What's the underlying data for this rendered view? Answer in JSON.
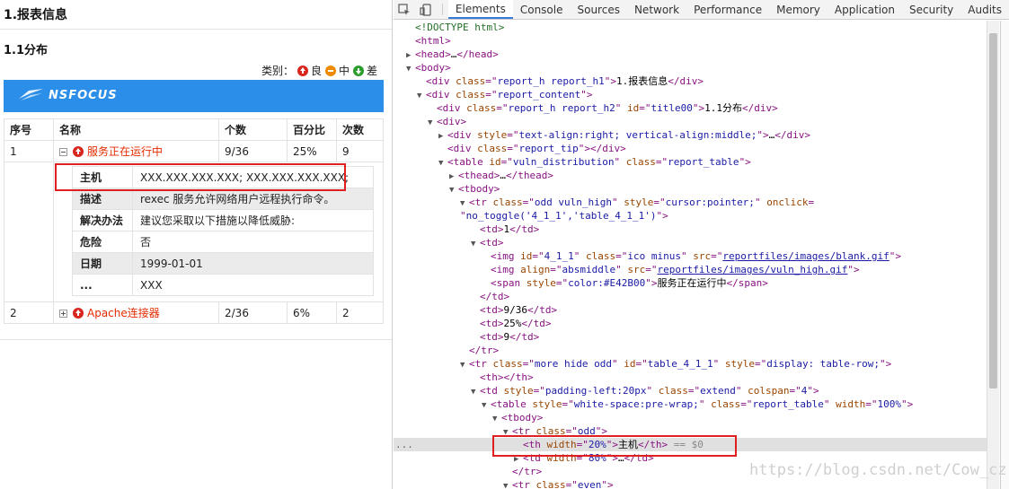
{
  "report": {
    "h1": "1.报表信息",
    "h2": "1.1分布",
    "legend": {
      "prefix": "类别：",
      "high": "良",
      "mid": "中",
      "low": "差"
    },
    "logo_text": "NSFOCUS",
    "headers": [
      "序号",
      "名称",
      "个数",
      "百分比",
      "次数"
    ],
    "rows": [
      {
        "no": "1",
        "name": "服务正在运行中",
        "count": "9/36",
        "pct": "25%",
        "times": "9"
      },
      {
        "no": "2",
        "name": "Apache连接器",
        "count": "2/36",
        "pct": "6%",
        "times": "2"
      }
    ],
    "detail": [
      {
        "k": "主机",
        "v": "XXX.XXX.XXX.XXX; XXX.XXX.XXX.XXX;"
      },
      {
        "k": "描述",
        "v": "rexec 服务允许网络用户远程执行命令。"
      },
      {
        "k": "解决办法",
        "v": "建议您采取以下措施以降低威胁:"
      },
      {
        "k": "危险",
        "v": "否"
      },
      {
        "k": "日期",
        "v": "1999-01-01"
      },
      {
        "k": "...",
        "v": "XXX"
      }
    ]
  },
  "devtools": {
    "tabs": [
      "Elements",
      "Console",
      "Sources",
      "Network",
      "Performance",
      "Memory",
      "Application",
      "Security",
      "Audits"
    ],
    "active_tab": "Elements",
    "dom_lines": [
      {
        "i": 0,
        "t": "",
        "h": [
          [
            "cm",
            "<!DOCTYPE html>"
          ]
        ]
      },
      {
        "i": 0,
        "t": "",
        "h": [
          [
            "tg",
            "<html>"
          ]
        ]
      },
      {
        "i": 0,
        "t": "▶",
        "h": [
          [
            "tg",
            "<head>"
          ],
          [
            "txt",
            "…"
          ],
          [
            "tg",
            "</head>"
          ]
        ]
      },
      {
        "i": 0,
        "t": "▼",
        "h": [
          [
            "tg",
            "<body>"
          ]
        ]
      },
      {
        "i": 1,
        "t": "",
        "h": [
          [
            "tg",
            "<div "
          ],
          [
            "an",
            "class"
          ],
          [
            "tg",
            "=\""
          ],
          [
            "av",
            "report_h report_h1"
          ],
          [
            "tg",
            "\">"
          ],
          [
            "txt",
            "1.报表信息"
          ],
          [
            "tg",
            "</div>"
          ]
        ]
      },
      {
        "i": 1,
        "t": "▼",
        "h": [
          [
            "tg",
            "<div "
          ],
          [
            "an",
            "class"
          ],
          [
            "tg",
            "=\""
          ],
          [
            "av",
            "report_content"
          ],
          [
            "tg",
            "\">"
          ]
        ]
      },
      {
        "i": 2,
        "t": "",
        "h": [
          [
            "tg",
            "<div "
          ],
          [
            "an",
            "class"
          ],
          [
            "tg",
            "=\""
          ],
          [
            "av",
            "report_h report_h2"
          ],
          [
            "tg",
            "\" "
          ],
          [
            "an",
            "id"
          ],
          [
            "tg",
            "=\""
          ],
          [
            "av",
            "title00"
          ],
          [
            "tg",
            "\">"
          ],
          [
            "txt",
            "1.1分布"
          ],
          [
            "tg",
            "</div>"
          ]
        ]
      },
      {
        "i": 2,
        "t": "▼",
        "h": [
          [
            "tg",
            "<div>"
          ]
        ]
      },
      {
        "i": 3,
        "t": "▶",
        "h": [
          [
            "tg",
            "<div "
          ],
          [
            "an",
            "style"
          ],
          [
            "tg",
            "=\""
          ],
          [
            "av",
            "text-align:right; vertical-align:middle;"
          ],
          [
            "tg",
            "\">"
          ],
          [
            "txt",
            "…"
          ],
          [
            "tg",
            "</div>"
          ]
        ]
      },
      {
        "i": 3,
        "t": "",
        "h": [
          [
            "tg",
            "<div "
          ],
          [
            "an",
            "class"
          ],
          [
            "tg",
            "=\""
          ],
          [
            "av",
            "report_tip"
          ],
          [
            "tg",
            "\">"
          ],
          [
            "tg",
            "</div>"
          ]
        ]
      },
      {
        "i": 3,
        "t": "▼",
        "h": [
          [
            "tg",
            "<table "
          ],
          [
            "an",
            "id"
          ],
          [
            "tg",
            "=\""
          ],
          [
            "av",
            "vuln_distribution"
          ],
          [
            "tg",
            "\" "
          ],
          [
            "an",
            "class"
          ],
          [
            "tg",
            "=\""
          ],
          [
            "av",
            "report_table"
          ],
          [
            "tg",
            "\">"
          ]
        ]
      },
      {
        "i": 4,
        "t": "▶",
        "h": [
          [
            "tg",
            "<thead>"
          ],
          [
            "txt",
            "…"
          ],
          [
            "tg",
            "</thead>"
          ]
        ]
      },
      {
        "i": 4,
        "t": "▼",
        "h": [
          [
            "tg",
            "<tbody>"
          ]
        ]
      },
      {
        "i": 5,
        "t": "▼",
        "h": [
          [
            "tg",
            "<tr "
          ],
          [
            "an",
            "class"
          ],
          [
            "tg",
            "=\""
          ],
          [
            "av",
            "odd vuln_high"
          ],
          [
            "tg",
            "\" "
          ],
          [
            "an",
            "style"
          ],
          [
            "tg",
            "=\""
          ],
          [
            "av",
            "cursor:pointer;"
          ],
          [
            "tg",
            "\" "
          ],
          [
            "an",
            "onclick"
          ],
          [
            "tg",
            "="
          ]
        ]
      },
      {
        "i": 5,
        "t": "",
        "w": 1,
        "h": [
          [
            "tg",
            "\""
          ],
          [
            "av",
            "no_toggle('4_1_1','table_4_1_1')"
          ],
          [
            "tg",
            "\">"
          ]
        ]
      },
      {
        "i": 6,
        "t": "",
        "h": [
          [
            "tg",
            "<td>"
          ],
          [
            "txt",
            "1"
          ],
          [
            "tg",
            "</td>"
          ]
        ]
      },
      {
        "i": 6,
        "t": "▼",
        "h": [
          [
            "tg",
            "<td>"
          ]
        ]
      },
      {
        "i": 7,
        "t": "",
        "h": [
          [
            "tg",
            "<img "
          ],
          [
            "an",
            "id"
          ],
          [
            "tg",
            "=\""
          ],
          [
            "av",
            "4_1_1"
          ],
          [
            "tg",
            "\" "
          ],
          [
            "an",
            "class"
          ],
          [
            "tg",
            "=\""
          ],
          [
            "av",
            "ico minus"
          ],
          [
            "tg",
            "\" "
          ],
          [
            "an",
            "src"
          ],
          [
            "tg",
            "=\""
          ],
          [
            "lnk",
            "reportfiles/images/blank.gif"
          ],
          [
            "tg",
            "\">"
          ]
        ]
      },
      {
        "i": 7,
        "t": "",
        "h": [
          [
            "tg",
            "<img "
          ],
          [
            "an",
            "align"
          ],
          [
            "tg",
            "=\""
          ],
          [
            "av",
            "absmiddle"
          ],
          [
            "tg",
            "\" "
          ],
          [
            "an",
            "src"
          ],
          [
            "tg",
            "=\""
          ],
          [
            "lnk",
            "reportfiles/images/vuln_high.gif"
          ],
          [
            "tg",
            "\">"
          ]
        ]
      },
      {
        "i": 7,
        "t": "",
        "h": [
          [
            "tg",
            "<span "
          ],
          [
            "an",
            "style"
          ],
          [
            "tg",
            "=\""
          ],
          [
            "av",
            "color:#E42B00"
          ],
          [
            "tg",
            "\">"
          ],
          [
            "txt",
            "服务正在运行中"
          ],
          [
            "tg",
            "</span>"
          ]
        ]
      },
      {
        "i": 6,
        "t": "",
        "h": [
          [
            "tg",
            "</td>"
          ]
        ]
      },
      {
        "i": 6,
        "t": "",
        "h": [
          [
            "tg",
            "<td>"
          ],
          [
            "txt",
            "9/36"
          ],
          [
            "tg",
            "</td>"
          ]
        ]
      },
      {
        "i": 6,
        "t": "",
        "h": [
          [
            "tg",
            "<td>"
          ],
          [
            "txt",
            "25%"
          ],
          [
            "tg",
            "</td>"
          ]
        ]
      },
      {
        "i": 6,
        "t": "",
        "h": [
          [
            "tg",
            "<td>"
          ],
          [
            "txt",
            "9"
          ],
          [
            "tg",
            "</td>"
          ]
        ]
      },
      {
        "i": 5,
        "t": "",
        "h": [
          [
            "tg",
            "</tr>"
          ]
        ]
      },
      {
        "i": 5,
        "t": "▼",
        "h": [
          [
            "tg",
            "<tr "
          ],
          [
            "an",
            "class"
          ],
          [
            "tg",
            "=\""
          ],
          [
            "av",
            "more hide odd"
          ],
          [
            "tg",
            "\" "
          ],
          [
            "an",
            "id"
          ],
          [
            "tg",
            "=\""
          ],
          [
            "av",
            "table_4_1_1"
          ],
          [
            "tg",
            "\" "
          ],
          [
            "an",
            "style"
          ],
          [
            "tg",
            "=\""
          ],
          [
            "av",
            "display: table-row;"
          ],
          [
            "tg",
            "\">"
          ]
        ]
      },
      {
        "i": 6,
        "t": "",
        "h": [
          [
            "tg",
            "<th></th>"
          ]
        ]
      },
      {
        "i": 6,
        "t": "▼",
        "h": [
          [
            "tg",
            "<td "
          ],
          [
            "an",
            "style"
          ],
          [
            "tg",
            "=\""
          ],
          [
            "av",
            "padding-left:20px"
          ],
          [
            "tg",
            "\" "
          ],
          [
            "an",
            "class"
          ],
          [
            "tg",
            "=\""
          ],
          [
            "av",
            "extend"
          ],
          [
            "tg",
            "\" "
          ],
          [
            "an",
            "colspan"
          ],
          [
            "tg",
            "=\""
          ],
          [
            "av",
            "4"
          ],
          [
            "tg",
            "\">"
          ]
        ]
      },
      {
        "i": 7,
        "t": "▼",
        "h": [
          [
            "tg",
            "<table "
          ],
          [
            "an",
            "style"
          ],
          [
            "tg",
            "=\""
          ],
          [
            "av",
            "white-space:pre-wrap;"
          ],
          [
            "tg",
            "\" "
          ],
          [
            "an",
            "class"
          ],
          [
            "tg",
            "=\""
          ],
          [
            "av",
            "report_table"
          ],
          [
            "tg",
            "\" "
          ],
          [
            "an",
            "width"
          ],
          [
            "tg",
            "=\""
          ],
          [
            "av",
            "100%"
          ],
          [
            "tg",
            "\">"
          ]
        ]
      },
      {
        "i": 8,
        "t": "▼",
        "h": [
          [
            "tg",
            "<tbody>"
          ]
        ]
      },
      {
        "i": 9,
        "t": "▼",
        "h": [
          [
            "tg",
            "<tr "
          ],
          [
            "an",
            "class"
          ],
          [
            "tg",
            "=\""
          ],
          [
            "av",
            "odd"
          ],
          [
            "tg",
            "\">"
          ]
        ]
      },
      {
        "i": 10,
        "t": "",
        "sel": 1,
        "h": [
          [
            "tg",
            "<th "
          ],
          [
            "an",
            "width"
          ],
          [
            "tg",
            "=\""
          ],
          [
            "av",
            "20%"
          ],
          [
            "tg",
            "\">"
          ],
          [
            "txt",
            "主机"
          ],
          [
            "tg",
            "</th>"
          ],
          [
            "ctrl",
            " == $0"
          ]
        ]
      },
      {
        "i": 10,
        "t": "▶",
        "h": [
          [
            "tg",
            "<td "
          ],
          [
            "an",
            "width"
          ],
          [
            "tg",
            "=\""
          ],
          [
            "av",
            "80%"
          ],
          [
            "tg",
            "\">"
          ],
          [
            "txt",
            "…"
          ],
          [
            "tg",
            "</td>"
          ]
        ]
      },
      {
        "i": 9,
        "t": "",
        "h": [
          [
            "tg",
            "</tr>"
          ]
        ]
      },
      {
        "i": 9,
        "t": "▼",
        "h": [
          [
            "tg",
            "<tr "
          ],
          [
            "an",
            "class"
          ],
          [
            "tg",
            "=\""
          ],
          [
            "av",
            "even"
          ],
          [
            "tg",
            "\">"
          ]
        ]
      }
    ],
    "watermark": "https://blog.csdn.net/Cow_cz"
  }
}
